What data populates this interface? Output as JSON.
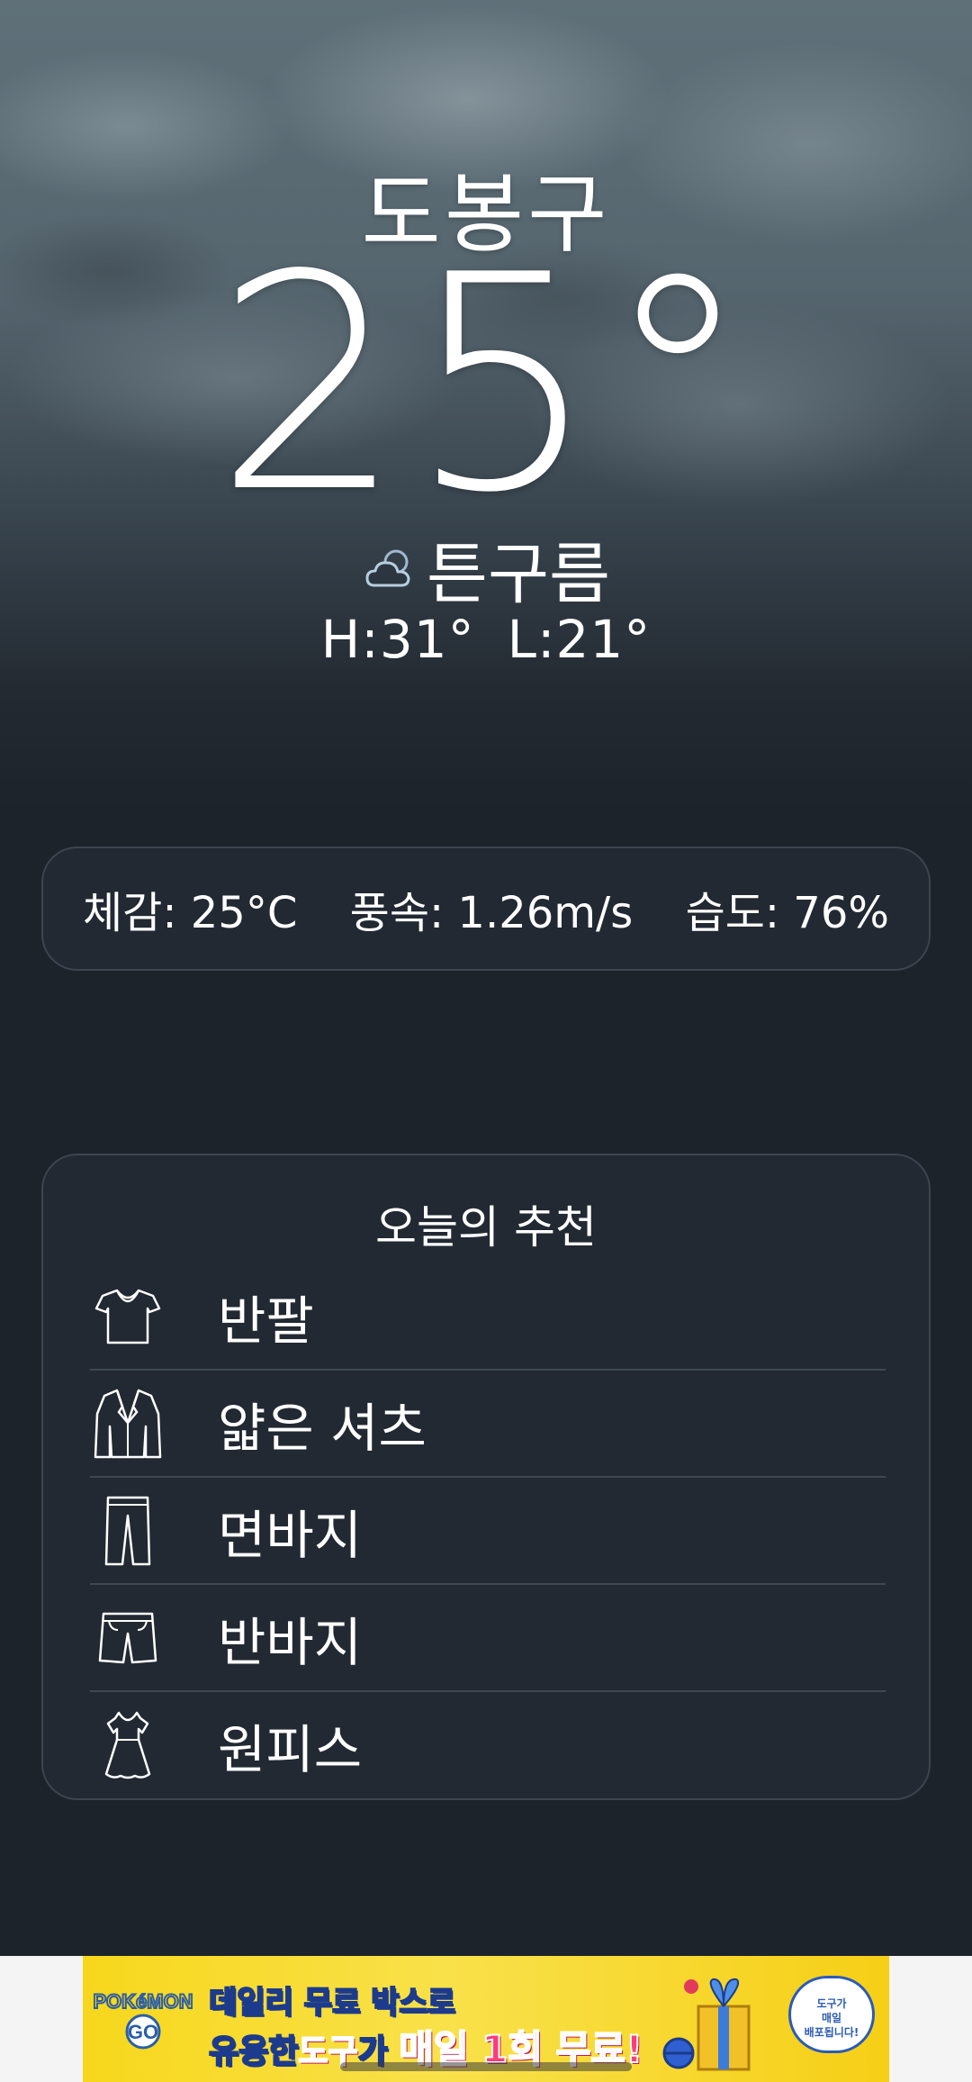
{
  "weather": {
    "city": "도봉구",
    "temperature": "25°",
    "condition": "튼구름",
    "condition_icon": "cloud-icon",
    "high": "H:31°",
    "low": "L:21°"
  },
  "details": {
    "feels_like": "체감: 25°C",
    "wind": "풍속: 1.26m/s",
    "humidity": "습도: 76%"
  },
  "recommendation": {
    "title": "오늘의 추천",
    "items": [
      {
        "label": "반팔",
        "icon": "tshirt-icon"
      },
      {
        "label": "얇은 셔츠",
        "icon": "jacket-icon"
      },
      {
        "label": "면바지",
        "icon": "pants-icon"
      },
      {
        "label": "반바지",
        "icon": "shorts-icon"
      },
      {
        "label": "원피스",
        "icon": "dress-icon"
      }
    ]
  },
  "ad": {
    "brand_line_1": "POKéMON",
    "brand_line_2": "GO",
    "line1": "데일리 무료 박스로",
    "line2_a": "유용한",
    "line2_b": "도구",
    "line2_c": "가 ",
    "line2_d": "매일 1회 무료!",
    "bubble_1": "도구가",
    "bubble_2": "매일",
    "bubble_3": "배포됩니다!",
    "help": "?"
  },
  "colors": {
    "background": "#1d232b",
    "card": "#222932",
    "card_border": "#3c4550",
    "ad_yellow": "#f7d71c"
  }
}
